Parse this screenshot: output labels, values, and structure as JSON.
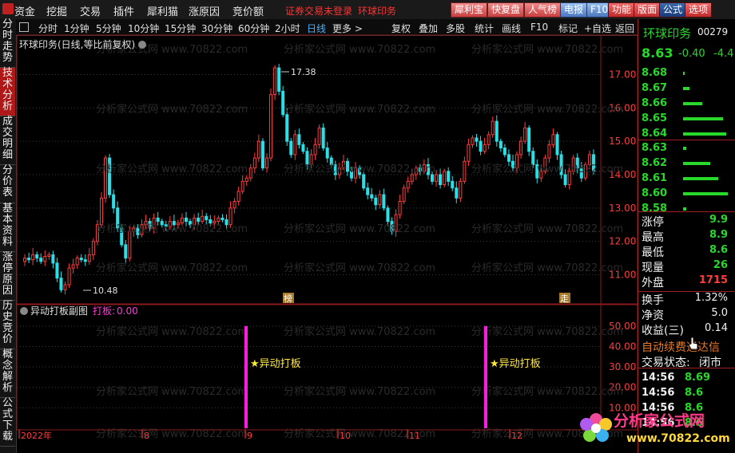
{
  "menu": {
    "items": [
      "资金",
      "挖掘",
      "交易",
      "插件",
      "犀利猫",
      "涨原因",
      "竞价额"
    ],
    "notice": "证券交易未登录",
    "stock": "环球印务"
  },
  "toolbar": {
    "buttons": [
      "犀利宝",
      "快复盘",
      "人气榜",
      "电报",
      "F10"
    ],
    "right": [
      "功能",
      "版面",
      "公式",
      "选项"
    ]
  },
  "sidebar": {
    "tabs": [
      "分时走势",
      "技术分析",
      "成交明细",
      "分价表",
      "基本资料",
      "涨停原因",
      "历史竞价",
      "概念解析",
      "公式下载"
    ],
    "active": 1
  },
  "timeframes": {
    "items": [
      "分时",
      "1分钟",
      "5分钟",
      "10分钟",
      "15分钟",
      "30分钟",
      "60分钟",
      "2小时",
      "日线",
      "更多 >"
    ],
    "active": 8
  },
  "actions": [
    "复权",
    "叠加",
    "多股",
    "统计",
    "画线",
    "F10",
    "标记",
    "+自选",
    "返回"
  ],
  "main_chart": {
    "title": "环球印务(日线,等比前复权)",
    "high_label": "17.38",
    "low_label": "10.48",
    "markers": [
      "榜",
      "走"
    ]
  },
  "indicator": {
    "title": "异动打板副图",
    "param_name": "打板:",
    "param_value": "0.00",
    "signal_label": "★异动打板"
  },
  "x_axis": {
    "labels": [
      "2022年",
      "8",
      "9",
      "10",
      "11",
      "12"
    ]
  },
  "chart_data": [
    {
      "type": "candlestick",
      "title": "环球印务(日线,等比前复权)",
      "y_ticks": [
        11.0,
        12.0,
        13.0,
        14.0,
        15.0,
        16.0,
        17.0
      ],
      "ylim": [
        10.2,
        17.8
      ],
      "x_ticks": [
        "2022年",
        "8",
        "9",
        "10",
        "11",
        "12"
      ],
      "annotations": [
        {
          "text": "17.38",
          "value": 17.38
        },
        {
          "text": "10.48",
          "value": 10.48
        }
      ],
      "close_path": [
        11.4,
        11.5,
        11.45,
        11.6,
        11.5,
        11.4,
        11.55,
        11.6,
        11.35,
        10.9,
        10.55,
        10.7,
        11.2,
        11.3,
        11.5,
        11.45,
        11.4,
        11.6,
        12.0,
        12.5,
        13.3,
        14.5,
        13.4,
        13.0,
        12.4,
        11.9,
        11.5,
        12.3,
        12.4,
        12.2,
        12.5,
        12.6,
        12.4,
        12.7,
        12.6,
        12.5,
        12.45,
        12.6,
        12.5,
        12.55,
        12.7,
        12.6,
        12.5,
        12.7,
        12.6,
        12.75,
        12.65,
        12.55,
        12.6,
        12.7,
        12.65,
        12.5,
        13.0,
        13.2,
        13.5,
        13.8,
        13.9,
        14.2,
        14.5,
        15.0,
        14.2,
        14.5,
        16.4,
        17.2,
        16.5,
        15.8,
        15.0,
        14.6,
        15.2,
        14.9,
        14.7,
        14.3,
        14.6,
        14.9,
        15.4,
        14.8,
        14.5,
        14.3,
        14.0,
        14.2,
        14.4,
        14.1,
        13.9,
        14.2,
        14.0,
        13.6,
        13.4,
        13.3,
        13.1,
        13.4,
        13.0,
        12.6,
        12.3,
        12.8,
        13.2,
        13.6,
        13.8,
        14.0,
        14.2,
        14.1,
        14.3,
        14.0,
        13.8,
        14.0,
        13.7,
        14.1,
        13.8,
        13.6,
        13.3,
        13.8,
        14.4,
        14.9,
        15.1,
        15.0,
        14.7,
        14.9,
        15.2,
        15.6,
        15.0,
        14.8,
        14.6,
        14.4,
        14.2,
        14.6,
        15.0,
        15.4,
        14.7,
        14.3,
        13.9,
        14.1,
        14.5,
        14.9,
        15.2,
        14.6,
        14.0,
        13.7,
        14.1,
        14.5,
        14.2,
        13.9,
        14.3,
        14.6,
        14.1
      ]
    },
    {
      "type": "bar",
      "title": "异动打板副图",
      "y_ticks": [
        10.0,
        20.0,
        30.0,
        40.0,
        50.0
      ],
      "ylim": [
        0,
        55
      ],
      "signals": [
        {
          "x_index": 65,
          "value": 50
        },
        {
          "x_index": 134,
          "value": 50
        }
      ]
    }
  ],
  "quote": {
    "name": "环球印务",
    "code": "00279",
    "price": "8.63",
    "change": "-0.40",
    "pct": "-4.4",
    "asks": [
      {
        "p": "8.68",
        "w": 2
      },
      {
        "p": "8.67",
        "w": 8
      },
      {
        "p": "8.66",
        "w": 24
      },
      {
        "p": "8.65",
        "w": 50
      },
      {
        "p": "8.64",
        "w": 54
      }
    ],
    "bids": [
      {
        "p": "8.63",
        "w": 4
      },
      {
        "p": "8.62",
        "w": 34
      },
      {
        "p": "8.61",
        "w": 44
      },
      {
        "p": "8.60",
        "w": 56
      },
      {
        "p": "8.58",
        "w": 4
      }
    ],
    "stats": [
      [
        "涨停",
        "9.9"
      ],
      [
        "最高",
        "8.9"
      ],
      [
        "最低",
        "8.6"
      ],
      [
        "现量",
        "26"
      ],
      [
        "外盘",
        "1715"
      ]
    ],
    "stats2": [
      [
        "换手",
        "1.32%"
      ],
      [
        "净资",
        "5.0"
      ],
      [
        "收益(三)",
        "0.14"
      ]
    ],
    "note": "自动续费通达信",
    "state_label": "交易状态:",
    "state_value": "闭市",
    "ticks": [
      [
        "14:56",
        "8.69"
      ],
      [
        "14:56",
        "8.6"
      ],
      [
        "14:56",
        "8.6"
      ],
      [
        "14:56",
        "8.6"
      ]
    ]
  },
  "watermark": {
    "text": "分析家公式网 www.70822.com",
    "logo_top": "分析家公式网",
    "logo_bottom": "www.70822.com"
  },
  "colors": {
    "up": "#ff3c3c",
    "down": "#28e0e8",
    "signal": "#ff1ce0",
    "grid": "#8a1a1a"
  }
}
